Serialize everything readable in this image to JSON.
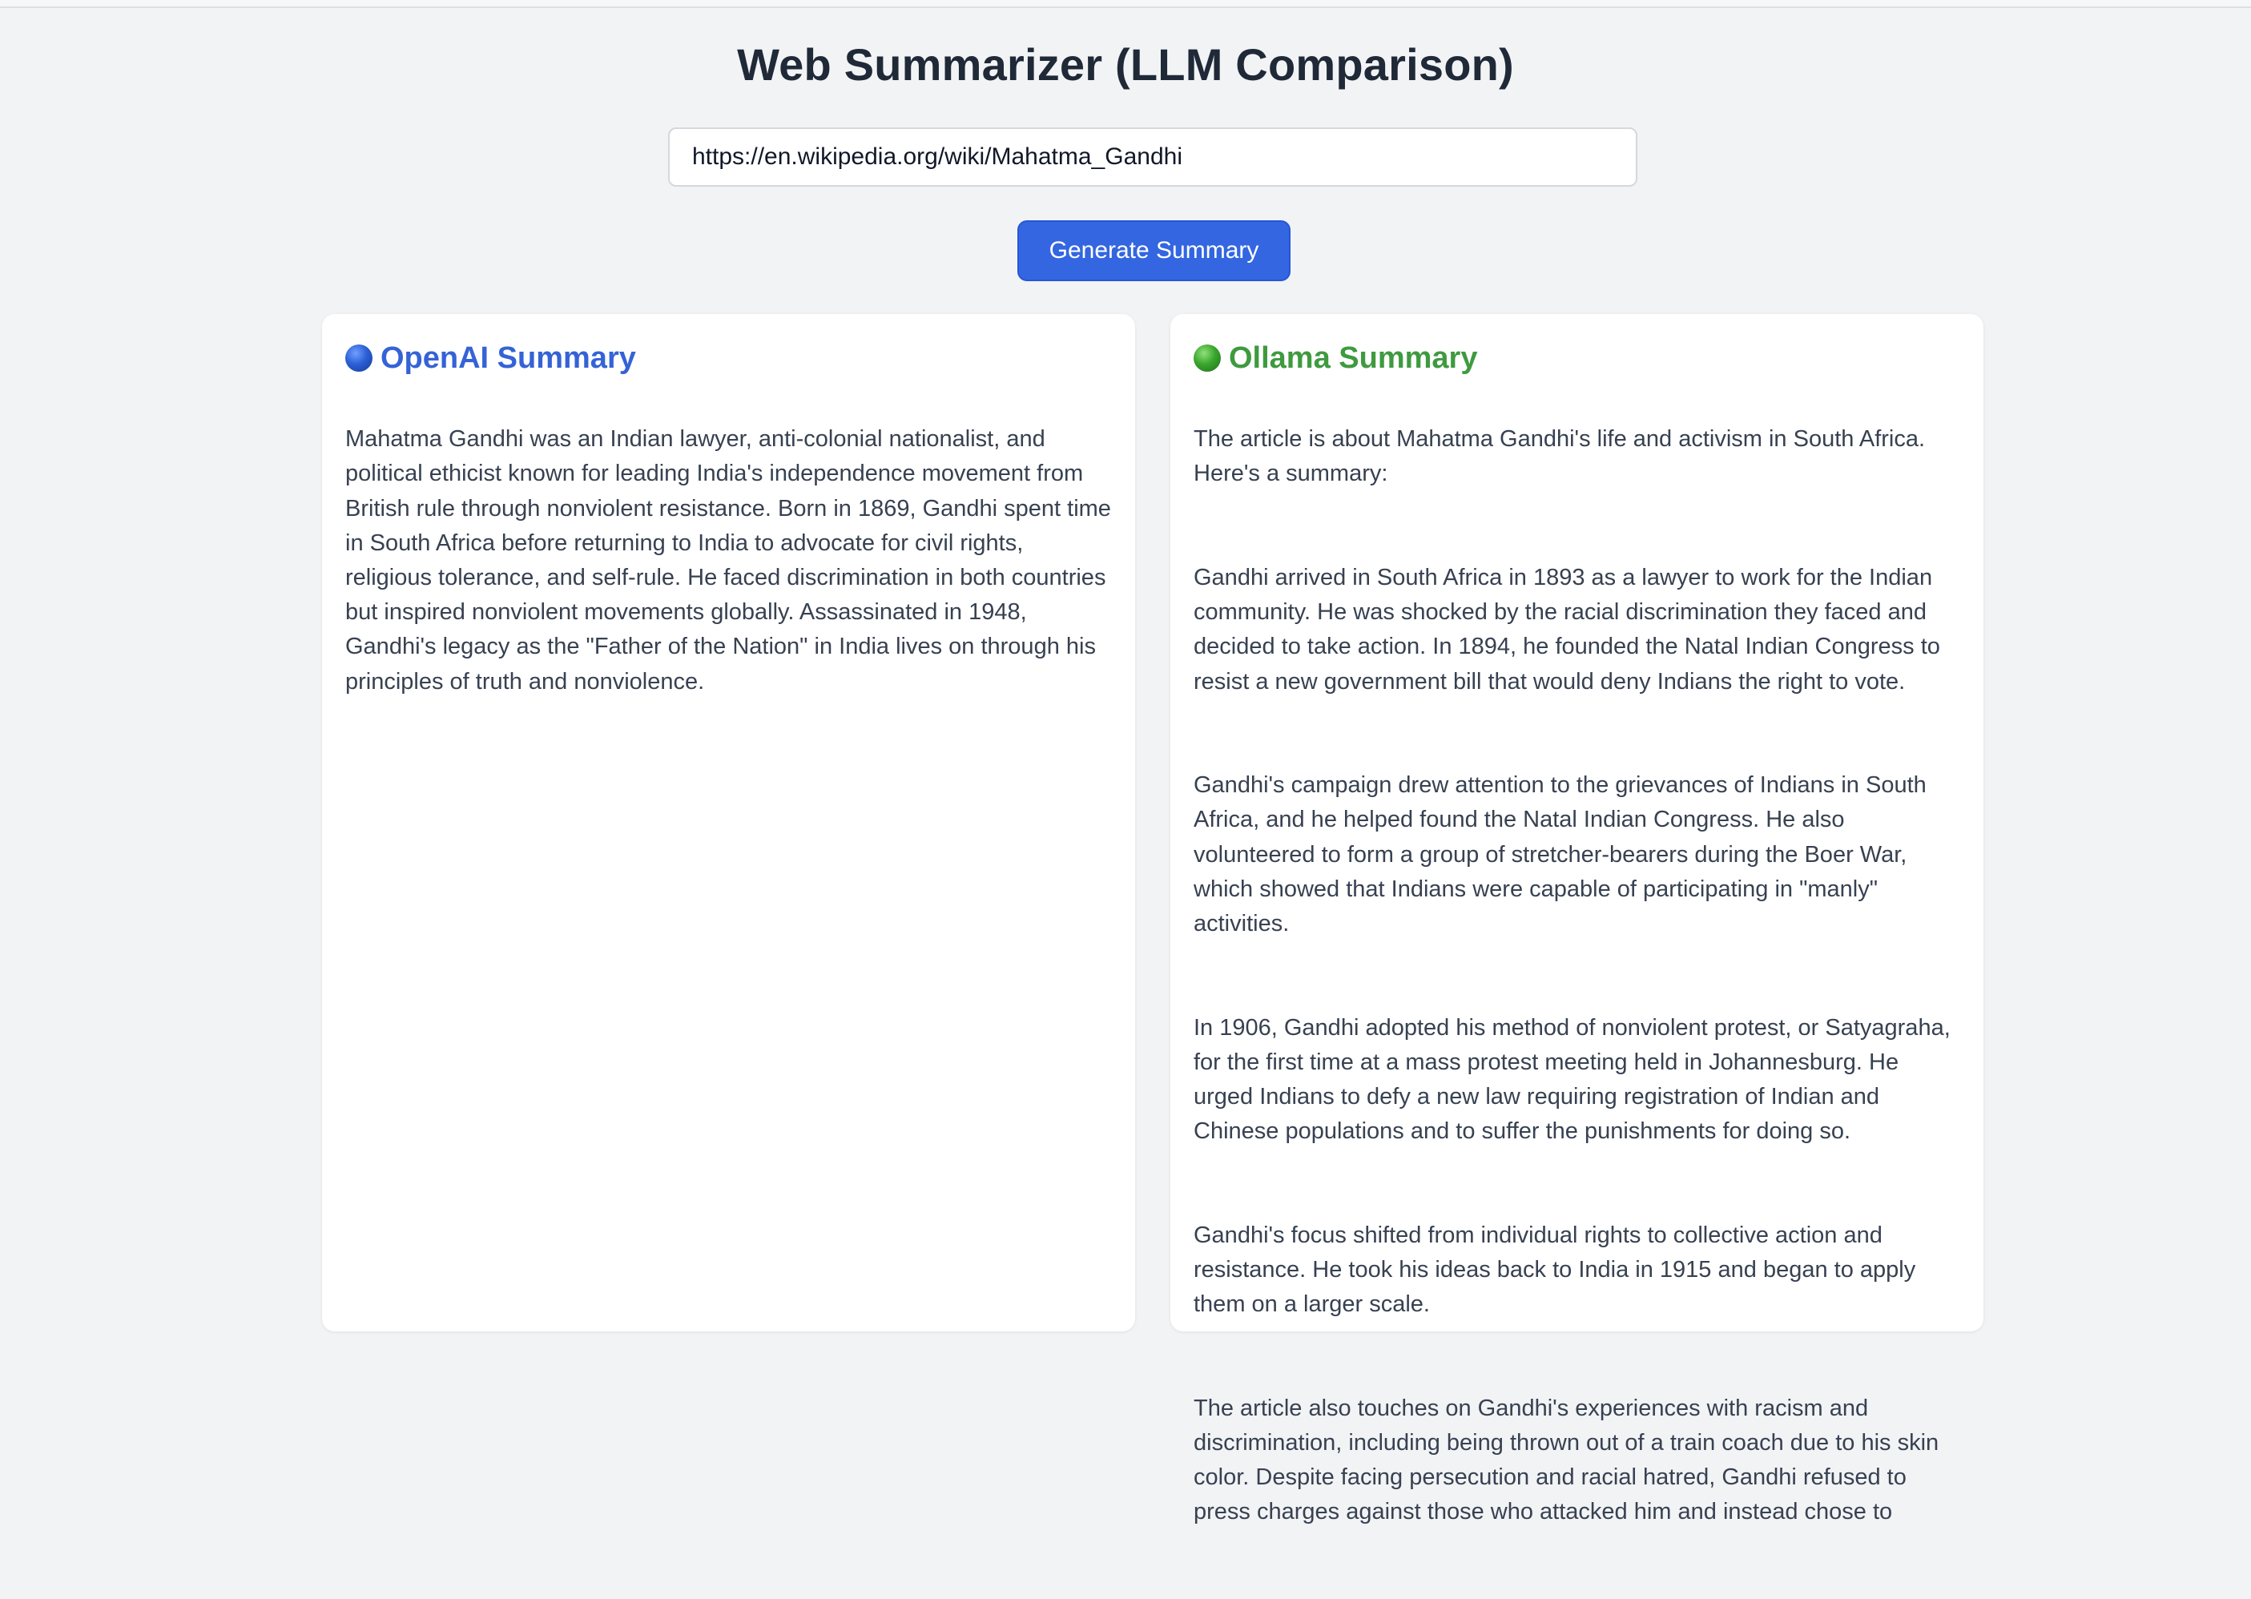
{
  "app": {
    "title": "Web Summarizer (LLM Comparison)"
  },
  "url_input": {
    "value": "https://en.wikipedia.org/wiki/Mahatma_Gandhi",
    "placeholder": ""
  },
  "generate_button": {
    "label": "Generate Summary"
  },
  "colors": {
    "accent_blue": "#3366e0",
    "openai_title": "#3563d6",
    "ollama_title": "#3f9a3f",
    "background": "#f2f3f5"
  },
  "openai": {
    "icon": "blue-circle-icon",
    "title": "OpenAI Summary",
    "paragraphs": [
      "Mahatma Gandhi was an Indian lawyer, anti-colonial nationalist, and political ethicist known for leading India's independence movement from British rule through nonviolent resistance. Born in 1869, Gandhi spent time in South Africa before returning to India to advocate for civil rights, religious tolerance, and self-rule. He faced discrimination in both countries but inspired nonviolent movements globally. Assassinated in 1948, Gandhi's legacy as the \"Father of the Nation\" in India lives on through his principles of truth and nonviolence."
    ]
  },
  "ollama": {
    "icon": "green-circle-icon",
    "title": "Ollama Summary",
    "paragraphs": [
      "The article is about Mahatma Gandhi's life and activism in South Africa. Here's a summary:",
      "Gandhi arrived in South Africa in 1893 as a lawyer to work for the Indian community. He was shocked by the racial discrimination they faced and decided to take action. In 1894, he founded the Natal Indian Congress to resist a new government bill that would deny Indians the right to vote.",
      "Gandhi's campaign drew attention to the grievances of Indians in South Africa, and he helped found the Natal Indian Congress. He also volunteered to form a group of stretcher-bearers during the Boer War, which showed that Indians were capable of participating in \"manly\" activities.",
      "In 1906, Gandhi adopted his method of nonviolent protest, or Satyagraha, for the first time at a mass protest meeting held in Johannesburg. He urged Indians to defy a new law requiring registration of Indian and Chinese populations and to suffer the punishments for doing so.",
      "Gandhi's focus shifted from individual rights to collective action and resistance. He took his ideas back to India in 1915 and began to apply them on a larger scale.",
      "The article also touches on Gandhi's experiences with racism and discrimination, including being thrown out of a train coach due to his skin color. Despite facing persecution and racial hatred, Gandhi refused to press charges against those who attacked him and instead chose to"
    ]
  }
}
